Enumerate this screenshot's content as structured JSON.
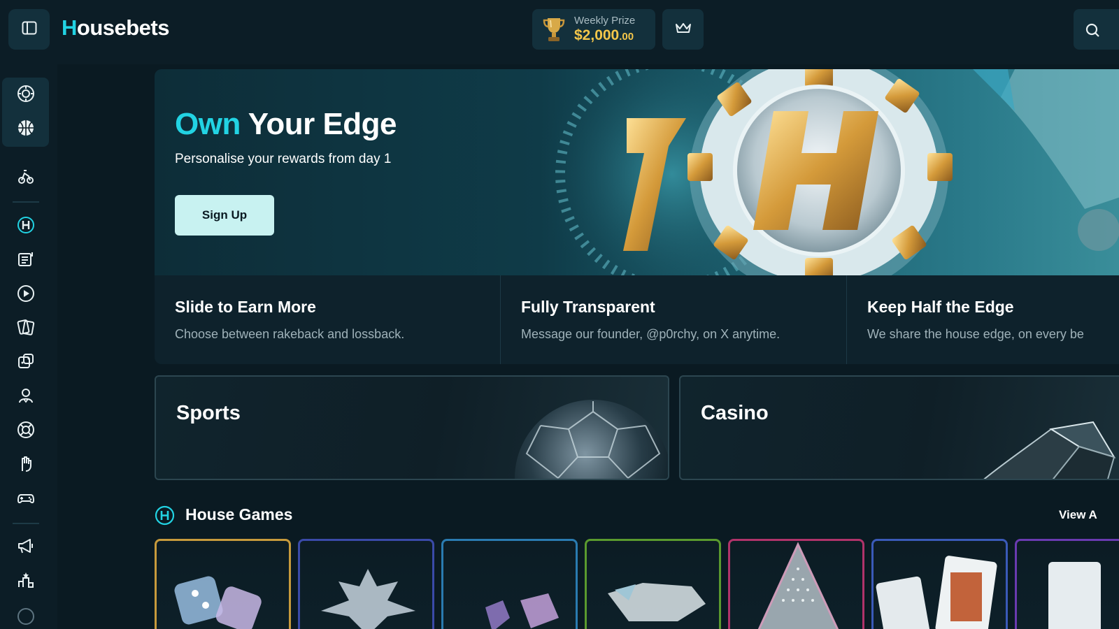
{
  "header": {
    "brand_first": "H",
    "brand_rest": "ousebets",
    "prize_label": "Weekly Prize",
    "prize_value_main": "$2,000",
    "prize_value_cents": ".00"
  },
  "hero": {
    "title_accent": "Own",
    "title_rest": " Your Edge",
    "subtitle": "Personalise your rewards from day 1",
    "signup_label": "Sign Up"
  },
  "features": [
    {
      "title": "Slide to Earn More",
      "desc": "Choose between rakeback and lossback."
    },
    {
      "title": "Fully Transparent",
      "desc": "Message our founder, @p0rchy, on X anytime."
    },
    {
      "title": "Keep Half the Edge",
      "desc": "We share the house edge, on every be"
    }
  ],
  "categories": {
    "sports": "Sports",
    "casino": "Casino"
  },
  "house_games": {
    "title": "House Games",
    "view_all": "View A"
  },
  "sidebar": {
    "items": [
      "casino-chip-icon",
      "basketball-icon",
      "bike-icon",
      "house-h-icon",
      "news-icon",
      "play-icon",
      "cards-icon",
      "dice-icon",
      "dealer-icon",
      "roulette-icon",
      "hand-icon",
      "gamepad-icon",
      "megaphone-icon",
      "leaderboard-icon"
    ]
  },
  "colors": {
    "accent": "#22d3e3",
    "prize": "#f3c64a",
    "background": "#0a1a22"
  }
}
